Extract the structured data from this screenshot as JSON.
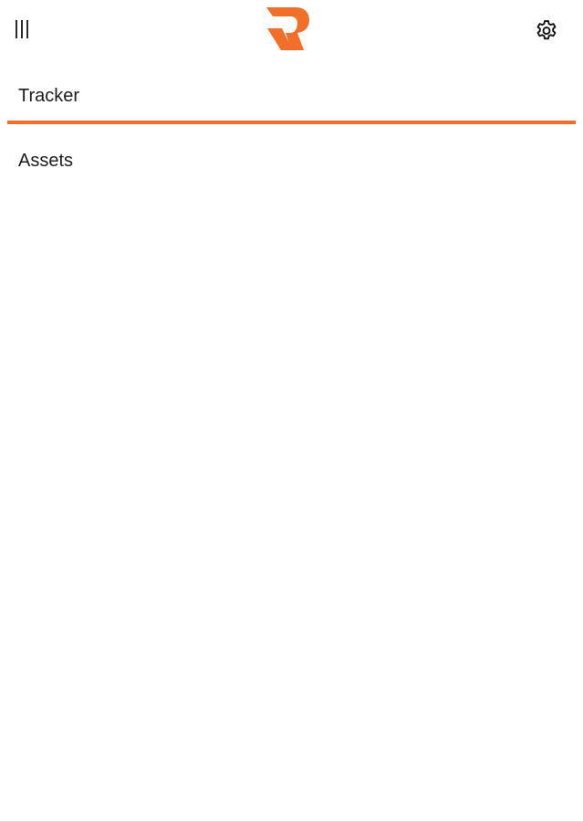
{
  "header": {
    "menu_icon": "menu-bars-icon",
    "logo_icon": "brand-r-logo-icon",
    "settings_icon": "gear-icon"
  },
  "nav": {
    "items": [
      {
        "label": "Tracker",
        "active": true
      },
      {
        "label": "Assets",
        "active": false
      }
    ]
  },
  "colors": {
    "accent": "#f26f2a",
    "text": "#1c1c1c",
    "background": "#ffffff"
  }
}
